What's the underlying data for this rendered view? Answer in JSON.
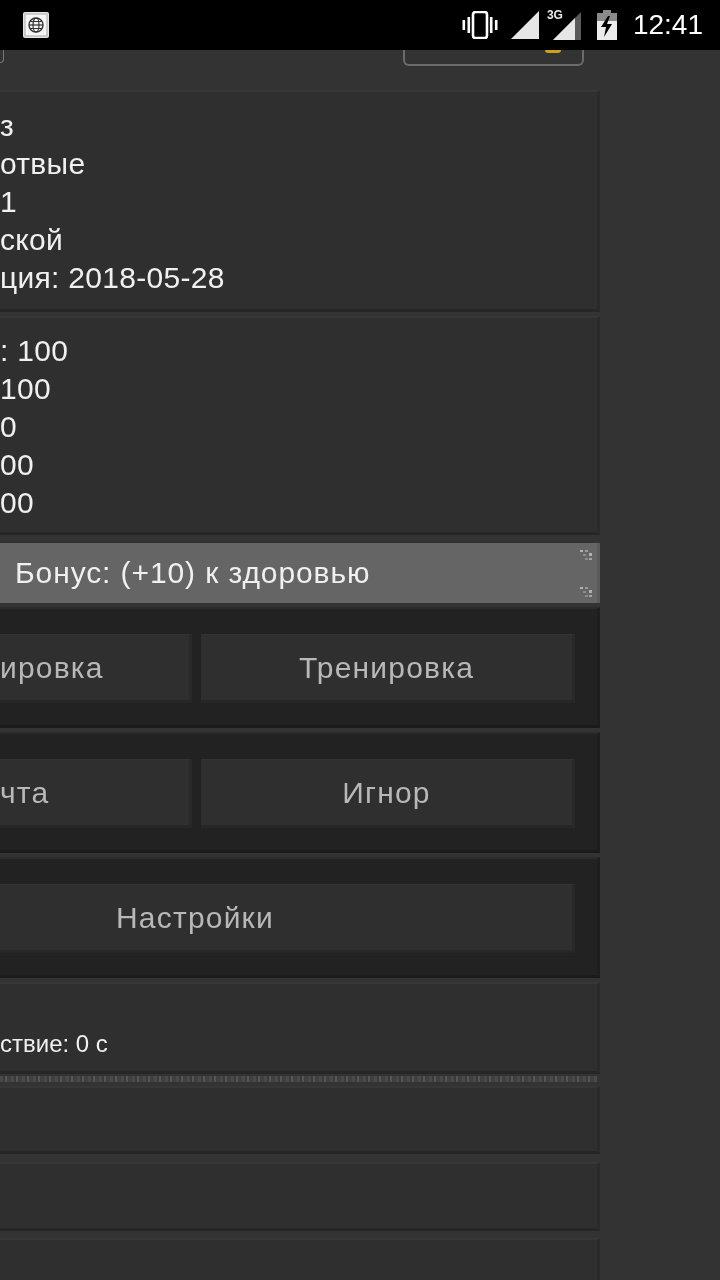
{
  "status_bar": {
    "network_type": "3G",
    "time": "12:41"
  },
  "info_panel": {
    "lines": [
      "з",
      "отвые",
      "1",
      "ской",
      "ция: 2018-05-28"
    ]
  },
  "stats_panel": {
    "lines": [
      ": 100",
      "100",
      "0",
      "00",
      "00"
    ]
  },
  "bonus_banner": {
    "text": "Бонус: (+10) к здоровью"
  },
  "button_rows": [
    {
      "buttons": [
        {
          "label": "ировка"
        },
        {
          "label": "Тренировка"
        }
      ]
    },
    {
      "buttons": [
        {
          "label": "чта"
        },
        {
          "label": "Игнор"
        }
      ]
    },
    {
      "buttons": [
        {
          "label": "Настройки"
        }
      ]
    }
  ],
  "status_panel": {
    "text": "ствие: 0 с"
  }
}
